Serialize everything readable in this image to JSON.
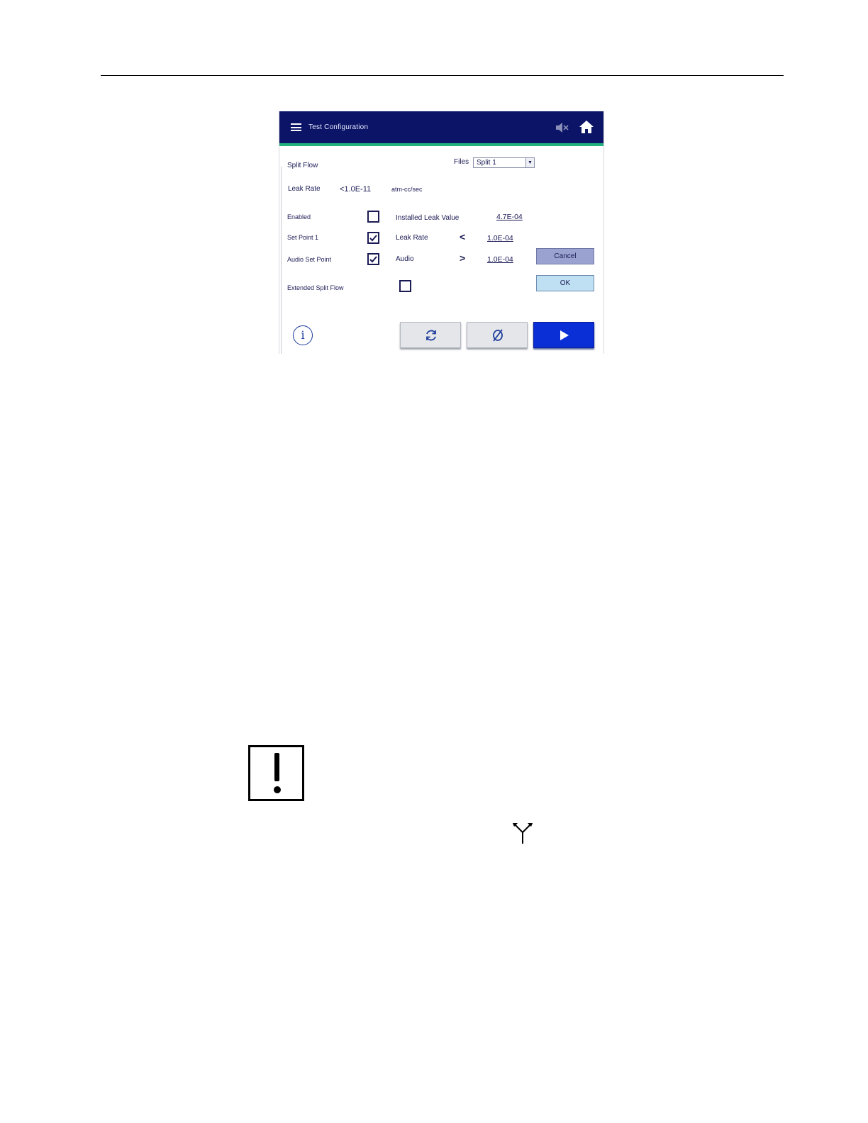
{
  "window": {
    "title": "Test Configuration",
    "menu_icon": "hamburger-menu-icon",
    "mute_icon": "speaker-muted-icon",
    "home_icon": "home-icon"
  },
  "colors": {
    "titlebar": "#0b1466",
    "accent": "#22b07d",
    "primary_button": "#0a2fd6",
    "cancel_button": "#9aa3cf",
    "ok_button": "#bfe0f2"
  },
  "form": {
    "section_title": "Split Flow",
    "files_label": "Files",
    "files_selected": "Split 1",
    "leak_rate_label": "Leak Rate",
    "leak_rate_value": "<1.0E-11",
    "leak_rate_unit": "atm-cc/sec",
    "enabled_label": "Enabled",
    "enabled_checked": false,
    "installed_leak_label": "Installed Leak Value",
    "installed_leak_value": "4.7E-04",
    "set_point_label": "Set Point 1",
    "set_point_checked": true,
    "set_point_leak_label": "Leak Rate",
    "set_point_comparator": "<",
    "set_point_value": "1.0E-04",
    "audio_set_point_label": "Audio Set Point",
    "audio_set_point_checked": true,
    "audio_label": "Audio",
    "audio_comparator": ">",
    "audio_value": "1.0E-04",
    "extended_split_flow_label": "Extended Split Flow",
    "extended_split_flow_checked": false
  },
  "buttons": {
    "cancel": "Cancel",
    "ok": "OK",
    "info_icon": "info-icon",
    "refresh_icon": "refresh-icon",
    "zero_icon": "zero-icon",
    "play_icon": "play-icon"
  },
  "page_icons": {
    "warning_icon": "exclamation-warning-icon",
    "split_icon": "split-flow-icon"
  }
}
